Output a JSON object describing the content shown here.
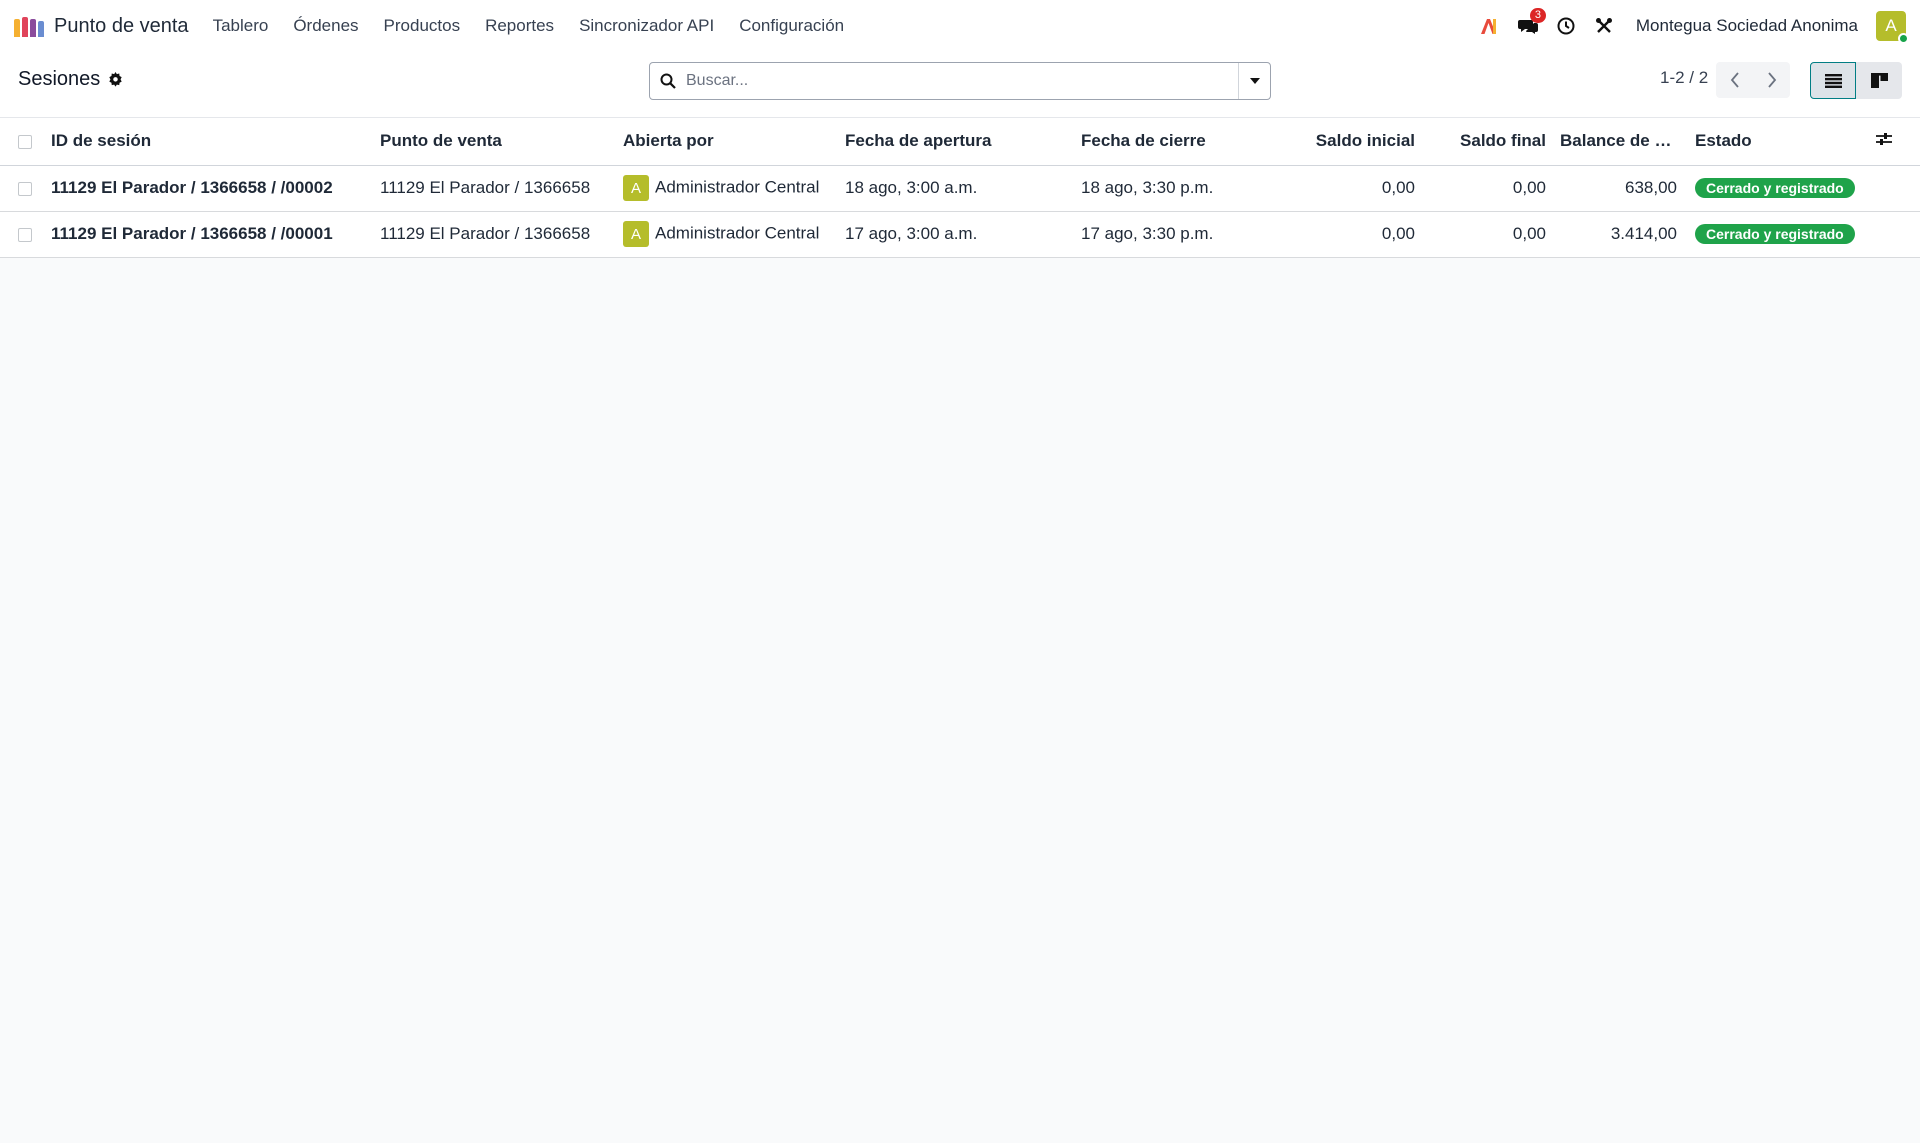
{
  "navbar": {
    "app_name": "Punto de venta",
    "logo_colors": [
      "#f5b031",
      "#e0445b",
      "#8a4b9c",
      "#6a8dd1"
    ],
    "menu": [
      "Tablero",
      "Órdenes",
      "Productos",
      "Reportes",
      "Sincronizador API",
      "Configuración"
    ],
    "message_count": "3",
    "company": "Montegua Sociedad Anonima",
    "user_initial": "A",
    "icons": [
      "ai-icon",
      "chat-icon",
      "clock-icon",
      "tools-icon"
    ]
  },
  "control": {
    "title": "Sesiones",
    "search_placeholder": "Buscar...",
    "pager": "1-2 / 2"
  },
  "table": {
    "columns": [
      "ID de sesión",
      "Punto de venta",
      "Abierta por",
      "Fecha de apertura",
      "Fecha de cierre",
      "Saldo inicial",
      "Saldo final",
      "Balance de ci...",
      "Estado"
    ],
    "rows": [
      {
        "session_id": "11129 El Parador / 1366658 / /00002",
        "pos": "11129 El Parador / 1366658",
        "opened_by_initial": "A",
        "opened_by": "Administrador Central",
        "opening_date": "18 ago, 3:00 a.m.",
        "closing_date": "18 ago, 3:30 p.m.",
        "opening_balance": "0,00",
        "closing_balance": "0,00",
        "balance": "638,00",
        "status": "Cerrado y registrado"
      },
      {
        "session_id": "11129 El Parador / 1366658 / /00001",
        "pos": "11129 El Parador / 1366658",
        "opened_by_initial": "A",
        "opened_by": "Administrador Central",
        "opening_date": "17 ago, 3:00 a.m.",
        "closing_date": "17 ago, 3:30 p.m.",
        "opening_balance": "0,00",
        "closing_balance": "0,00",
        "balance": "3.414,00",
        "status": "Cerrado y registrado"
      }
    ]
  },
  "colors": {
    "accent": "#017e84",
    "status_done": "#1fa34a",
    "avatar": "#b5bd2b",
    "badge": "#dc2626"
  }
}
